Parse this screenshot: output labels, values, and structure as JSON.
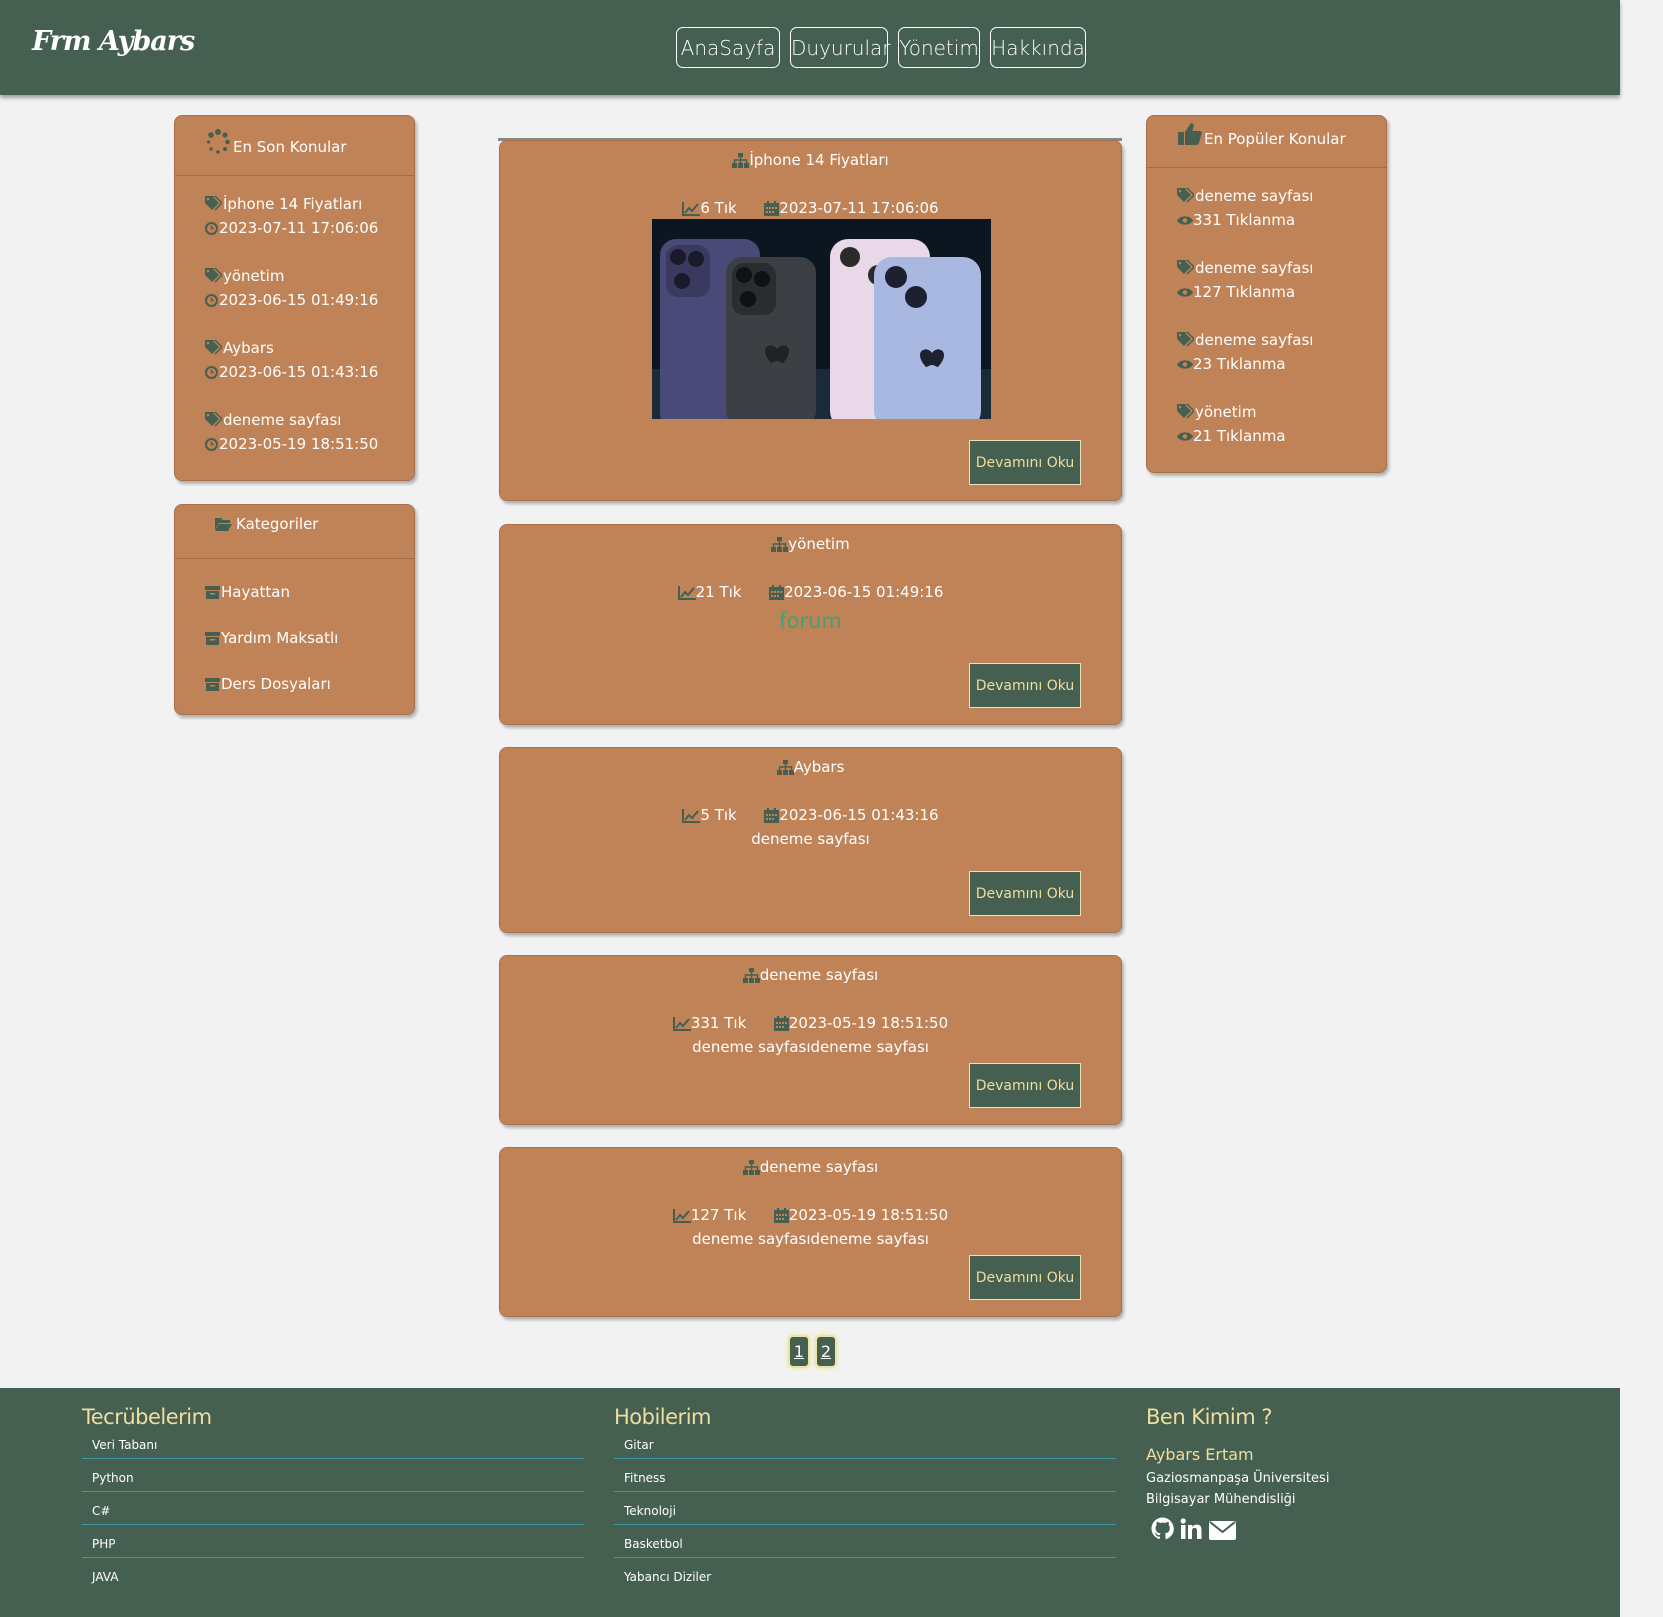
{
  "header": {
    "logo": "Frm Aybars",
    "nav": [
      "AnaSayfa",
      "Duyurular",
      "Yönetim",
      "Hakkında"
    ]
  },
  "recent": {
    "title": "En Son Konular",
    "items": [
      {
        "label": "İphone 14 Fiyatları",
        "date": "2023-07-11 17:06:06"
      },
      {
        "label": "yönetim",
        "date": "2023-06-15 01:49:16"
      },
      {
        "label": "Aybars",
        "date": "2023-06-15 01:43:16"
      },
      {
        "label": "deneme sayfası",
        "date": "2023-05-19 18:51:50"
      }
    ]
  },
  "categories": {
    "title": "Kategoriler",
    "items": [
      "Hayattan",
      "Yardım Maksatlı",
      "Ders Dosyaları"
    ]
  },
  "popular": {
    "title": "En Popüler Konular",
    "items": [
      {
        "label": "deneme sayfası",
        "views": "331 Tıklanma"
      },
      {
        "label": "deneme sayfası",
        "views": "127 Tıklanma"
      },
      {
        "label": "deneme sayfası",
        "views": "23 Tıklanma"
      },
      {
        "label": "yönetim",
        "views": "21 Tıklanma"
      }
    ]
  },
  "posts": [
    {
      "title": "İphone 14 Fiyatları",
      "clicks": "6 Tık",
      "date": "2023-07-11 17:06:06",
      "body": "",
      "button": "Devamını Oku"
    },
    {
      "title": "yönetim",
      "clicks": "21 Tık",
      "date": "2023-06-15 01:49:16",
      "body": "forum",
      "button": "Devamını Oku"
    },
    {
      "title": "Aybars",
      "clicks": "5 Tık",
      "date": "2023-06-15 01:43:16",
      "body": "deneme sayfası",
      "button": "Devamını Oku"
    },
    {
      "title": "deneme sayfası",
      "clicks": "331 Tık",
      "date": "2023-05-19 18:51:50",
      "body": "deneme sayfasıdeneme sayfası",
      "button": "Devamını Oku"
    },
    {
      "title": "deneme sayfası",
      "clicks": "127 Tık",
      "date": "2023-05-19 18:51:50",
      "body": "deneme sayfasıdeneme sayfası",
      "button": "Devamını Oku"
    }
  ],
  "pagination": [
    "1",
    "2"
  ],
  "footer": {
    "experience": {
      "title": "Tecrübelerim",
      "items": [
        "Veri Tabanı",
        "Python",
        "C#",
        "PHP",
        "JAVA"
      ]
    },
    "hobbies": {
      "title": "Hobilerim",
      "items": [
        "Gitar",
        "Fitness",
        "Teknoloji",
        "Basketbol",
        "Yabancı Diziler"
      ]
    },
    "about": {
      "title": "Ben Kimim ?",
      "name": "Aybars Ertam",
      "line1": "Gaziosmanpaşa Üniversitesi",
      "line2": "Bilgisayar Mühendisliği"
    }
  },
  "colors": {
    "header": "#455f51",
    "panel": "#c08358",
    "accent": "#f0dda0",
    "forum_text": "#3fa178"
  },
  "icons": [
    "spinner-icon",
    "tag-icon",
    "clock-icon",
    "folder-open-icon",
    "archive-icon",
    "thumbs-up-icon",
    "eye-icon",
    "sitemap-icon",
    "line-chart-icon",
    "calendar-icon",
    "github-icon",
    "linkedin-icon",
    "envelope-icon"
  ]
}
